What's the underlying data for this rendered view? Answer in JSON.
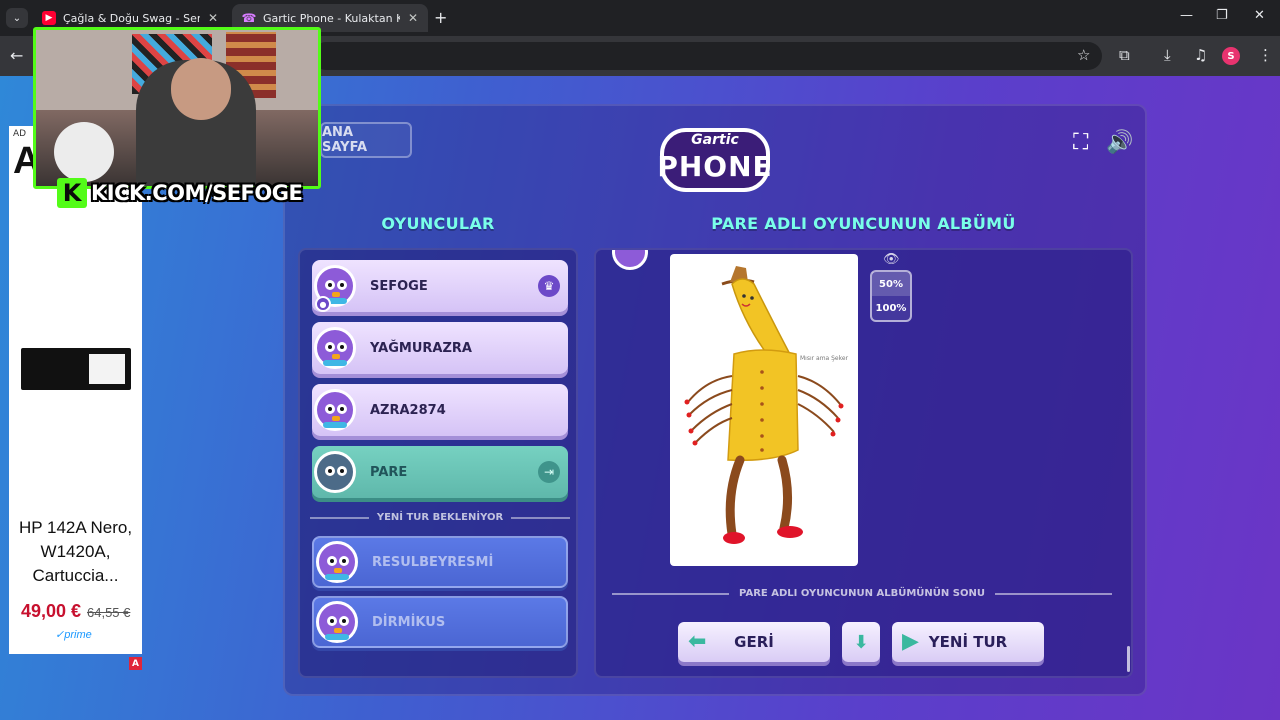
{
  "browser": {
    "tabs": [
      {
        "title": "Çağla & Doğu Swag - Seni Dü",
        "active": false,
        "favicon": "youtube-icon"
      },
      {
        "title": "Gartic Phone - Kulaktan Kulağa",
        "active": true,
        "favicon": "gartic-phone-icon"
      }
    ],
    "profile_initial": "S"
  },
  "ad": {
    "tag": "AD",
    "brand": "A",
    "product_name": "HP 142A Nero, W1420A, Cartuccia...",
    "price": "49,00 €",
    "old_price": "64,55 €",
    "prime": "✓prime",
    "badge": "A"
  },
  "webcam": {
    "kick_letter": "K",
    "url": "KICK.COM/SEFOGE"
  },
  "game": {
    "home_button": "ANA SAYFA",
    "logo_top": "Gartic",
    "logo_bottom": "PHONE",
    "players_title": "OYUNCULAR",
    "album_title": "PARE ADLI OYUNCUNUN ALBÜMÜ",
    "players": [
      {
        "name": "SEFOGE",
        "style": "light",
        "badge": "crown"
      },
      {
        "name": "YAĞMURAZRA",
        "style": "light"
      },
      {
        "name": "AZRA2874",
        "style": "light"
      },
      {
        "name": "PARE",
        "style": "teal",
        "badge": "leave"
      }
    ],
    "waiting_label": "YENİ TUR BEKLENİYOR",
    "waiting_players": [
      {
        "name": "RESULBEYRESMİ"
      },
      {
        "name": "DİRMİKUS"
      }
    ],
    "zoom_options": [
      "50%",
      "100%"
    ],
    "album_end_label": "PARE ADLI OYUNCUNUN ALBÜMÜNÜN SONU",
    "back_button": "GERİ",
    "new_round_button": "YENİ TUR",
    "drawing_caption": "Mısır ama Şeker"
  },
  "colors": {
    "accent_title": "#79ffe9",
    "kick_green": "#53fc18",
    "price_red": "#c7102e"
  }
}
